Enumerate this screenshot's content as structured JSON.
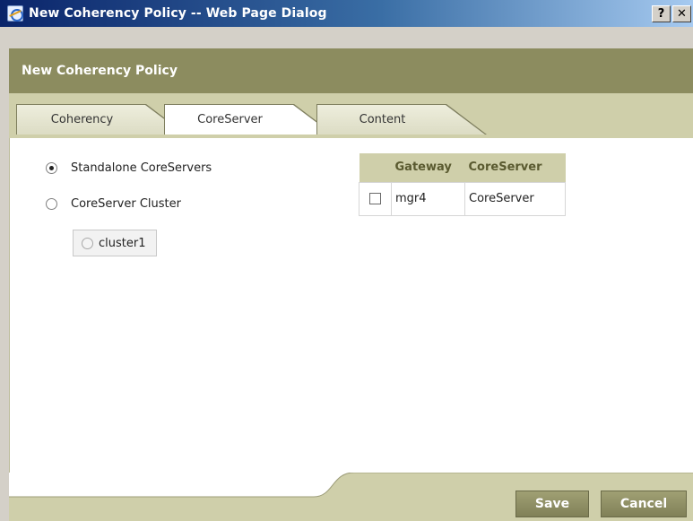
{
  "window": {
    "title": "New Coherency Policy -- Web Page Dialog",
    "help_label": "?",
    "close_label": "✕"
  },
  "header": {
    "title": "New Coherency Policy"
  },
  "tabs": [
    {
      "label": "Coherency",
      "active": false
    },
    {
      "label": "CoreServer",
      "active": true
    },
    {
      "label": "Content",
      "active": false
    }
  ],
  "options": {
    "standalone_label": "Standalone CoreServers",
    "standalone_selected": true,
    "cluster_label": "CoreServer Cluster",
    "cluster_selected": false,
    "clusters": [
      {
        "label": "cluster1",
        "selected": false,
        "enabled": false
      }
    ]
  },
  "table": {
    "columns": [
      "",
      "Gateway",
      "CoreServer"
    ],
    "rows": [
      {
        "checked": false,
        "gateway": "mgr4",
        "coreserver": "CoreServer"
      }
    ]
  },
  "footer": {
    "save_label": "Save",
    "cancel_label": "Cancel"
  },
  "colors": {
    "header_bg": "#8c8c5f",
    "tabstrip_bg": "#cfcfaa",
    "button_bg": "#8a8a62",
    "titlebar": "#0a246a"
  }
}
